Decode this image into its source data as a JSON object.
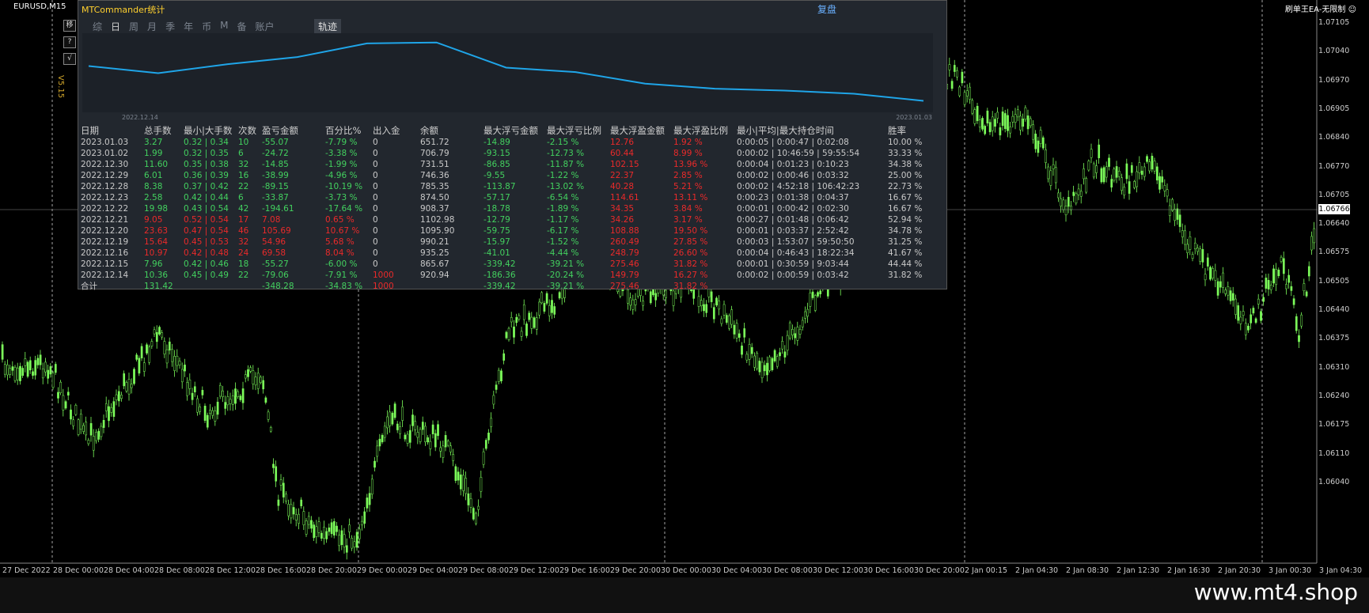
{
  "symbol": "EURUSD,M15",
  "top_right": "刷单王EA-无限制 ☺",
  "watermark": "www.mt4.shop",
  "version": "V5.15",
  "side_buttons": [
    "移",
    "?",
    "√"
  ],
  "panel": {
    "title": "MTCommander统计",
    "review": "复盘",
    "tabs": [
      "综",
      "日",
      "周",
      "月",
      "季",
      "年",
      "币",
      "M",
      "备",
      "账户"
    ],
    "active_tab": "日",
    "track_button": "轨迹",
    "mini_chart": {
      "start_date": "2022.12.14",
      "end_date": "2023.01.03",
      "line_color": "#1fa5e8",
      "balance_series": [
        920.94,
        865.67,
        935.25,
        990.21,
        1095.9,
        1102.98,
        908.37,
        874.5,
        785.35,
        746.36,
        731.51,
        706.79,
        651.72
      ]
    },
    "table": {
      "headers": [
        "日期",
        "总手数",
        "最小|大手数",
        "次数",
        "盈亏金额",
        "百分比%",
        "出入金",
        "余额",
        "最大浮亏金额",
        "最大浮亏比例",
        "最大浮盈金额",
        "最大浮盈比例",
        "最小|平均|最大持仓时间",
        "胜率"
      ],
      "rows": [
        [
          "2023.01.03",
          "3.27",
          "0.32 | 0.34",
          "10",
          "-55.07",
          "-7.79 %",
          "0",
          "651.72",
          "-14.89",
          "-2.15 %",
          "12.76",
          "1.92 %",
          "0:00:05 | 0:00:47 | 0:02:08",
          "10.00 %"
        ],
        [
          "2023.01.02",
          "1.99",
          "0.32 | 0.35",
          "6",
          "-24.72",
          "-3.38 %",
          "0",
          "706.79",
          "-93.15",
          "-12.73 %",
          "60.44",
          "8.99 %",
          "0:00:02 | 10:46:59 | 59:55:54",
          "33.33 %"
        ],
        [
          "2022.12.30",
          "11.60",
          "0.35 | 0.38",
          "32",
          "-14.85",
          "-1.99 %",
          "0",
          "731.51",
          "-86.85",
          "-11.87 %",
          "102.15",
          "13.96 %",
          "0:00:04 | 0:01:23 | 0:10:23",
          "34.38 %"
        ],
        [
          "2022.12.29",
          "6.01",
          "0.36 | 0.39",
          "16",
          "-38.99",
          "-4.96 %",
          "0",
          "746.36",
          "-9.55",
          "-1.22 %",
          "22.37",
          "2.85 %",
          "0:00:02 | 0:00:46 | 0:03:32",
          "25.00 %"
        ],
        [
          "2022.12.28",
          "8.38",
          "0.37 | 0.42",
          "22",
          "-89.15",
          "-10.19 %",
          "0",
          "785.35",
          "-113.87",
          "-13.02 %",
          "40.28",
          "5.21 %",
          "0:00:02 | 4:52:18 | 106:42:23",
          "22.73 %"
        ],
        [
          "2022.12.23",
          "2.58",
          "0.42 | 0.44",
          "6",
          "-33.87",
          "-3.73 %",
          "0",
          "874.50",
          "-57.17",
          "-6.54 %",
          "114.61",
          "13.11 %",
          "0:00:23 | 0:01:38 | 0:04:37",
          "16.67 %"
        ],
        [
          "2022.12.22",
          "19.98",
          "0.43 | 0.54",
          "42",
          "-194.61",
          "-17.64 %",
          "0",
          "908.37",
          "-18.78",
          "-1.89 %",
          "34.35",
          "3.84 %",
          "0:00:01 | 0:00:42 | 0:02:30",
          "16.67 %"
        ],
        [
          "2022.12.21",
          "9.05",
          "0.52 | 0.54",
          "17",
          "7.08",
          "0.65 %",
          "0",
          "1102.98",
          "-12.79",
          "-1.17 %",
          "34.26",
          "3.17 %",
          "0:00:27 | 0:01:48 | 0:06:42",
          "52.94 %"
        ],
        [
          "2022.12.20",
          "23.63",
          "0.47 | 0.54",
          "46",
          "105.69",
          "10.67 %",
          "0",
          "1095.90",
          "-59.75",
          "-6.17 %",
          "108.88",
          "19.50 %",
          "0:00:01 | 0:03:37 | 2:52:42",
          "34.78 %"
        ],
        [
          "2022.12.19",
          "15.64",
          "0.45 | 0.53",
          "32",
          "54.96",
          "5.68 %",
          "0",
          "990.21",
          "-15.97",
          "-1.52 %",
          "260.49",
          "27.85 %",
          "0:00:03 | 1:53:07 | 59:50:50",
          "31.25 %"
        ],
        [
          "2022.12.16",
          "10.97",
          "0.42 | 0.48",
          "24",
          "69.58",
          "8.04 %",
          "0",
          "935.25",
          "-41.01",
          "-4.44 %",
          "248.79",
          "26.60 %",
          "0:00:04 | 0:46:43 | 18:22:34",
          "41.67 %"
        ],
        [
          "2022.12.15",
          "7.96",
          "0.42 | 0.46",
          "18",
          "-55.27",
          "-6.00 %",
          "0",
          "865.67",
          "-339.42",
          "-39.21 %",
          "275.46",
          "31.82 %",
          "0:00:01 | 0:30:59 | 9:03:44",
          "44.44 %"
        ],
        [
          "2022.12.14",
          "10.36",
          "0.45 | 0.49",
          "22",
          "-79.06",
          "-7.91 %",
          "1000",
          "920.94",
          "-186.36",
          "-20.24 %",
          "149.79",
          "16.27 %",
          "0:00:02 | 0:00:59 | 0:03:42",
          "31.82 %"
        ]
      ],
      "total": [
        "合计",
        "131.42",
        "",
        "",
        "-348.28",
        "-34.83 %",
        "1000",
        "",
        "-339.42",
        "-39.21 %",
        "275.46",
        "31.82 %",
        "",
        ""
      ]
    }
  },
  "price_axis": {
    "labels": [
      "1.07105",
      "1.07040",
      "1.06970",
      "1.06905",
      "1.06840",
      "1.06770",
      "1.06705",
      "1.06640",
      "1.06575",
      "1.06505",
      "1.06440",
      "1.06375",
      "1.06310",
      "1.06240",
      "1.06175",
      "1.06110",
      "1.06040"
    ],
    "current": "1.06766"
  },
  "time_axis": [
    "27 Dec 2022",
    "28 Dec 00:00",
    "28 Dec 04:00",
    "28 Dec 08:00",
    "28 Dec 12:00",
    "28 Dec 16:00",
    "28 Dec 20:00",
    "29 Dec 00:00",
    "29 Dec 04:00",
    "29 Dec 08:00",
    "29 Dec 12:00",
    "29 Dec 16:00",
    "29 Dec 20:00",
    "30 Dec 00:00",
    "30 Dec 04:00",
    "30 Dec 08:00",
    "30 Dec 12:00",
    "30 Dec 16:00",
    "30 Dec 20:00",
    "2 Jan 00:15",
    "2 Jan 04:30",
    "2 Jan 08:30",
    "2 Jan 12:30",
    "2 Jan 16:30",
    "2 Jan 20:30",
    "3 Jan 00:30",
    "3 Jan 04:30"
  ],
  "colors": {
    "bull": "#7cfc5a",
    "bear": "#2fb32a",
    "grid": "#cccccc",
    "panel_bg": "#22272e"
  }
}
